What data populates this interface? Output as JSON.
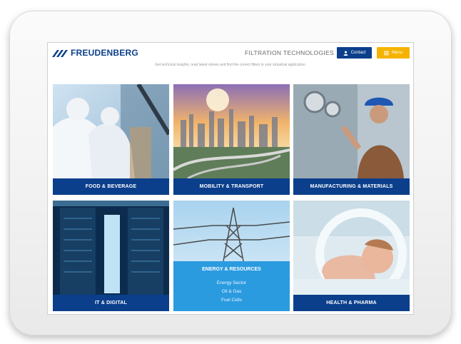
{
  "header": {
    "brand": "FREUDENBERG",
    "section": "FILTRATION TECHNOLOGIES",
    "contact_label": "Contact",
    "menu_label": "Menu"
  },
  "intro_text": "Get technical insights, read latest stories and find the correct filters to your industrial application.",
  "tiles": [
    {
      "label": "FOOD & BEVERAGE"
    },
    {
      "label": "MOBILITY & TRANSPORT"
    },
    {
      "label": "MANUFACTURING & MATERIALS"
    },
    {
      "label": "IT & DIGITAL"
    },
    {
      "label": "ENERGY & RESOURCES",
      "sub_items": [
        "Energy Sector",
        "Oil & Gas",
        "Fuel Cells"
      ]
    },
    {
      "label": "HEALTH & PHARMA"
    }
  ],
  "colors": {
    "brand_blue": "#0b3f8c",
    "menu_yellow": "#f5b300",
    "energy_blue": "#2b9be0"
  }
}
